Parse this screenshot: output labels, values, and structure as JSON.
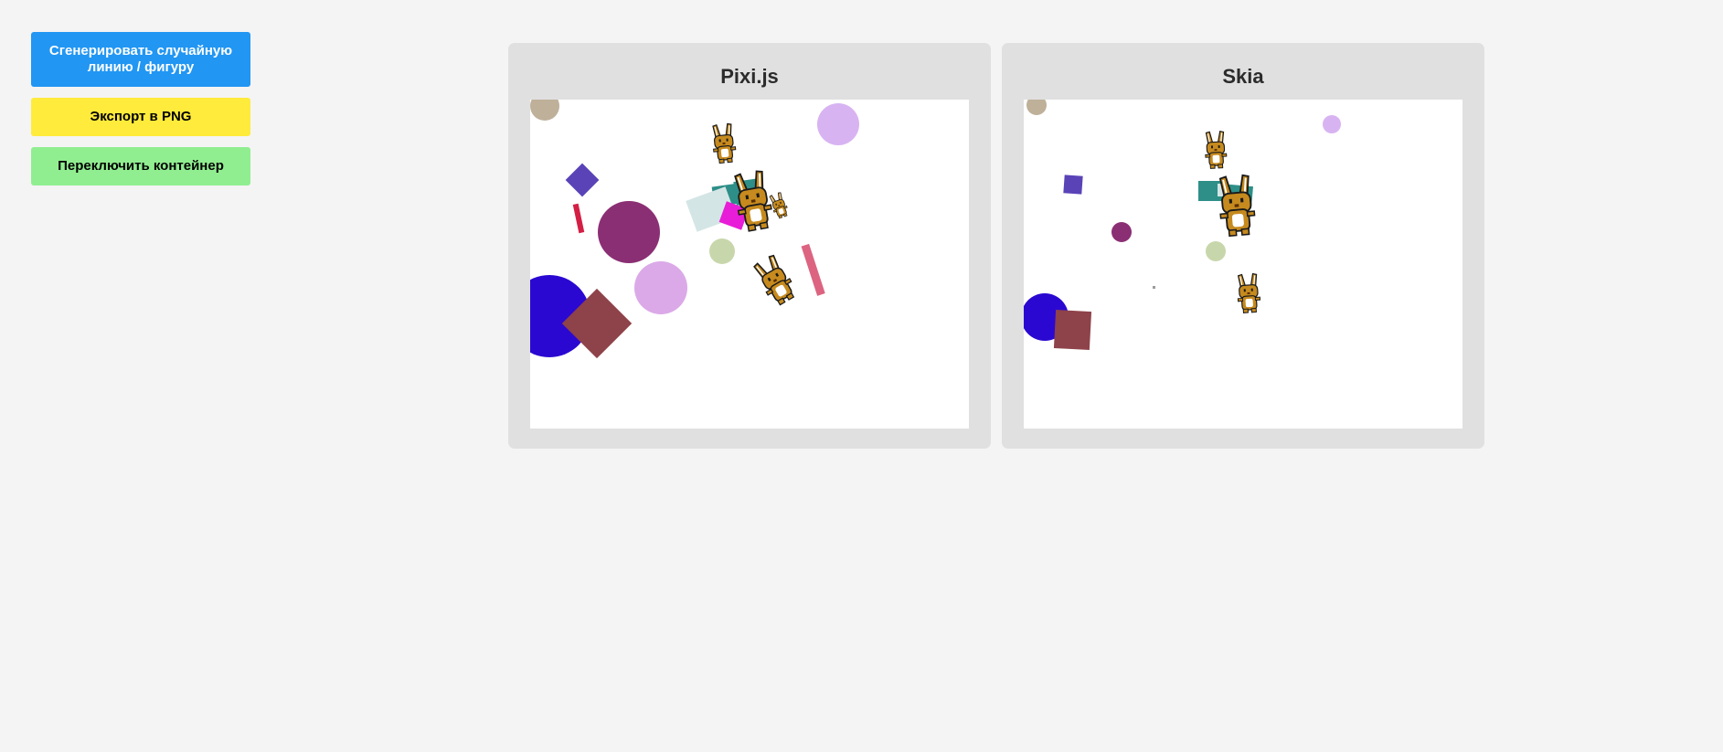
{
  "toolbar": {
    "generate_label": "Сгенерировать случайную линию / фигуру",
    "export_label": "Экспорт в PNG",
    "toggle_label": "Переключить контейнер"
  },
  "panels": [
    {
      "title": "Pixi.js"
    },
    {
      "title": "Skia"
    }
  ],
  "colors": {
    "page_background": "#f4f4f4",
    "panel_background": "#e0e0e0",
    "canvas_background": "#ffffff",
    "generate_button": "#2196f3",
    "export_button": "#ffeb3b",
    "toggle_button": "#90ee90"
  },
  "icons": {
    "sprite": "bunny-icon"
  }
}
